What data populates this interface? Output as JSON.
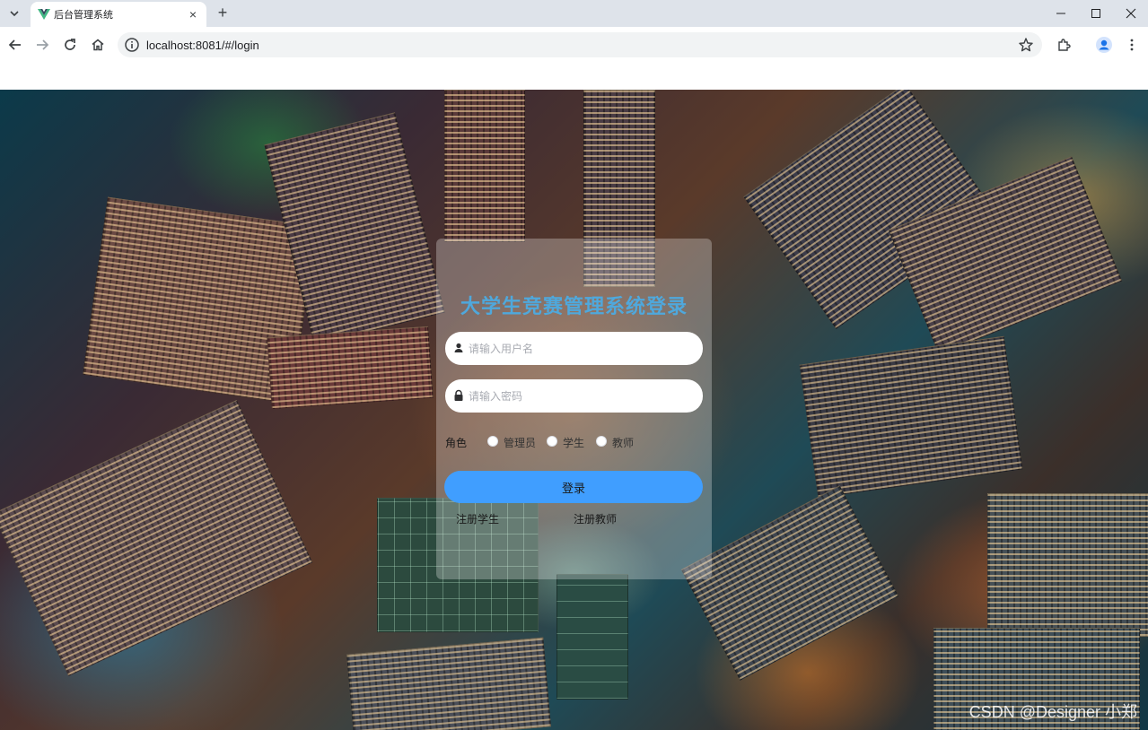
{
  "browser": {
    "tab_title": "后台管理系统",
    "url": "localhost:8081/#/login",
    "new_tab_symbol": "+",
    "close_symbol": "×"
  },
  "login": {
    "title": "大学生竞赛管理系统登录",
    "username_placeholder": "请输入用户名",
    "password_placeholder": "请输入密码",
    "role_label": "角色",
    "roles": [
      "管理员",
      "学生",
      "教师"
    ],
    "login_button": "登录",
    "register_student": "注册学生",
    "register_teacher": "注册教师"
  },
  "watermark": "CSDN @Designer 小郑",
  "colors": {
    "accent": "#409eff",
    "title": "#4fa8dc",
    "tabbar": "#dee3ea"
  },
  "icons": [
    "chevron-down-icon",
    "vue-logo-icon",
    "close-icon",
    "plus-icon",
    "minimize-icon",
    "maximize-icon",
    "back-icon",
    "forward-icon",
    "reload-icon",
    "home-icon",
    "info-icon",
    "star-icon",
    "extensions-icon",
    "profile-icon",
    "more-icon",
    "user-icon",
    "lock-icon"
  ]
}
